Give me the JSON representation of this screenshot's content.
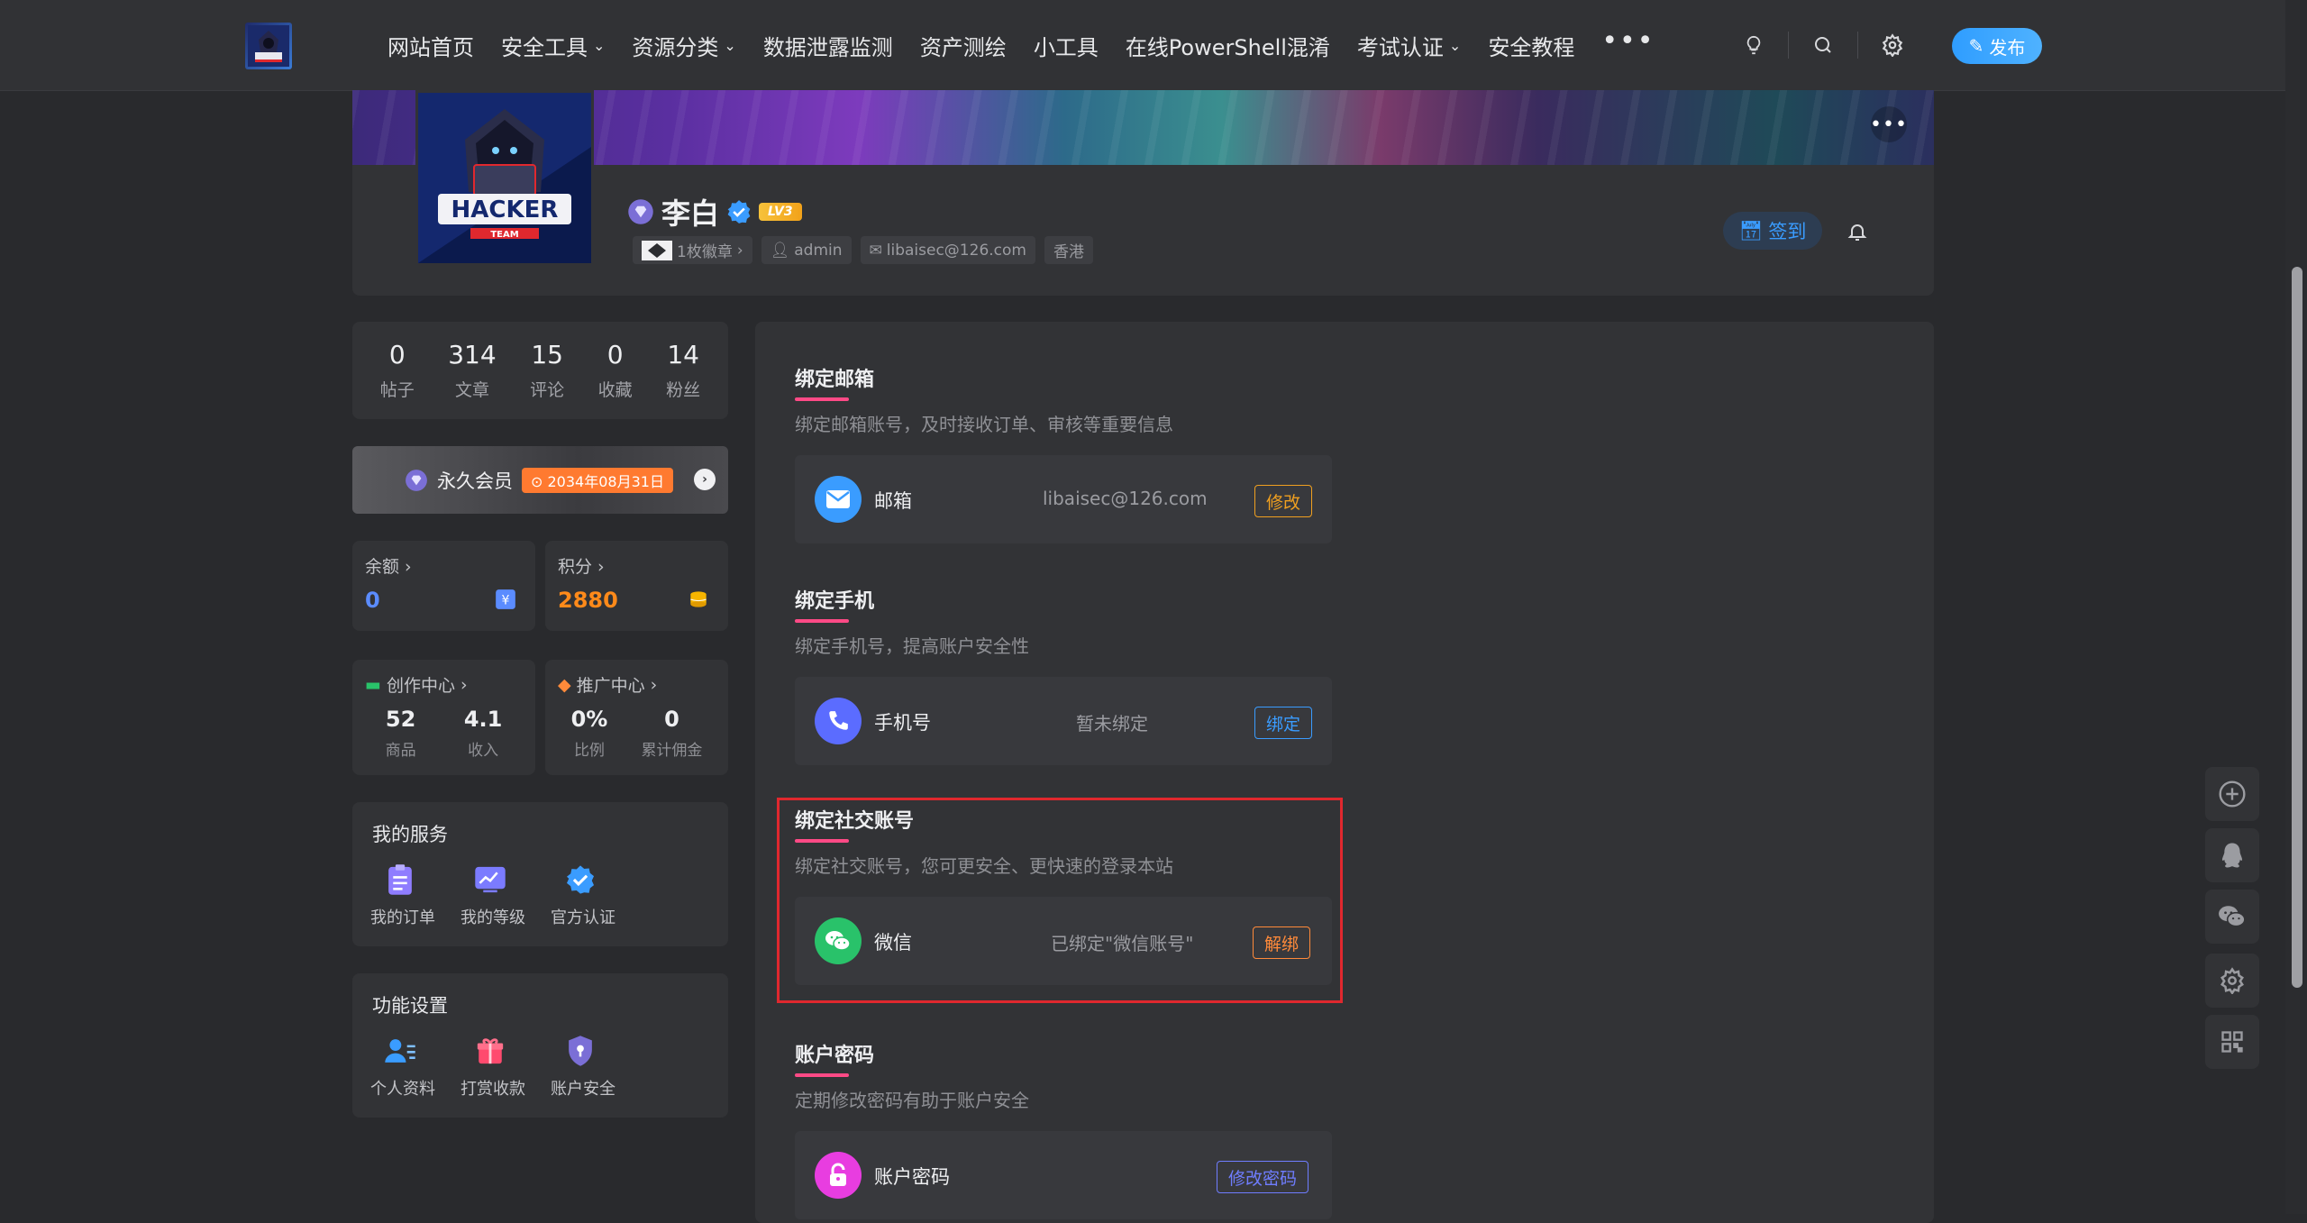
{
  "header": {
    "nav": [
      {
        "label": "网站首页",
        "caret": false
      },
      {
        "label": "安全工具",
        "caret": true
      },
      {
        "label": "资源分类",
        "caret": true
      },
      {
        "label": "数据泄露监测",
        "caret": false
      },
      {
        "label": "资产测绘",
        "caret": false
      },
      {
        "label": "小工具",
        "caret": false
      },
      {
        "label": "在线PowerShell混淆",
        "caret": false
      },
      {
        "label": "考试认证",
        "caret": true
      },
      {
        "label": "安全教程",
        "caret": false
      }
    ],
    "more": "•••",
    "publish_label": "发布"
  },
  "profile": {
    "name": "李白",
    "level": "LV3",
    "badges": "1枚徽章",
    "role": "admin",
    "email": "libaisec@126.com",
    "location": "香港",
    "signin_label": "签到",
    "avatar_text": "HACKER",
    "avatar_subtext": "TEAM"
  },
  "stats": [
    {
      "num": "0",
      "label": "帖子"
    },
    {
      "num": "314",
      "label": "文章"
    },
    {
      "num": "15",
      "label": "评论"
    },
    {
      "num": "0",
      "label": "收藏"
    },
    {
      "num": "14",
      "label": "粉丝"
    }
  ],
  "vip": {
    "label": "永久会员",
    "expire": "2034年08月31日"
  },
  "balance": {
    "title": "余额",
    "value": "0"
  },
  "points": {
    "title": "积分",
    "value": "2880"
  },
  "creator": {
    "title": "创作中心",
    "items": [
      {
        "num": "52",
        "label": "商品"
      },
      {
        "num": "4.1",
        "label": "收入"
      }
    ]
  },
  "promo": {
    "title": "推广中心",
    "items": [
      {
        "num": "0%",
        "label": "比例"
      },
      {
        "num": "0",
        "label": "累计佣金"
      }
    ]
  },
  "services": {
    "title": "我的服务",
    "items": [
      {
        "label": "我的订单",
        "icon": "clipboard-icon"
      },
      {
        "label": "我的等级",
        "icon": "chart-icon"
      },
      {
        "label": "官方认证",
        "icon": "verified-icon"
      }
    ]
  },
  "settings": {
    "title": "功能设置",
    "items": [
      {
        "label": "个人资料",
        "icon": "user-profile-icon"
      },
      {
        "label": "打赏收款",
        "icon": "gift-icon"
      },
      {
        "label": "账户安全",
        "icon": "shield-icon"
      }
    ]
  },
  "sections": {
    "email": {
      "title": "绑定邮箱",
      "desc": "绑定邮箱账号，及时接收订单、审核等重要信息",
      "name": "邮箱",
      "value": "libaisec@126.com",
      "action": "修改"
    },
    "phone": {
      "title": "绑定手机",
      "desc": "绑定手机号，提高账户安全性",
      "name": "手机号",
      "value": "暂未绑定",
      "action": "绑定"
    },
    "social": {
      "title": "绑定社交账号",
      "desc": "绑定社交账号，您可更安全、更快速的登录本站",
      "name": "微信",
      "value": "已绑定\"微信账号\"",
      "action": "解绑"
    },
    "password": {
      "title": "账户密码",
      "desc": "定期修改密码有助于账户安全",
      "name": "账户密码",
      "action": "修改密码"
    }
  },
  "colors": {
    "accent_blue": "#3a9cff",
    "accent_pink": "#ff4a86",
    "points_orange": "#ff8a1a",
    "balance_blue": "#5b8cff",
    "highlight_red": "#e0282e"
  }
}
